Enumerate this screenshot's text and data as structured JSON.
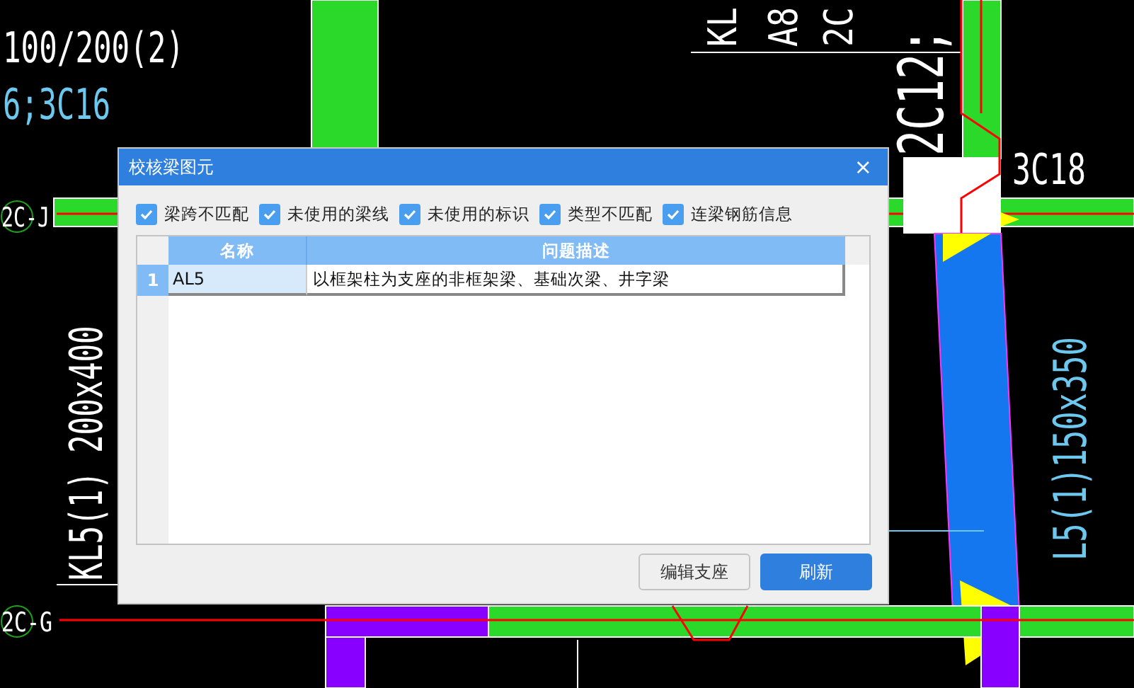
{
  "cad_labels": [
    {
      "text": "100/200(2)",
      "color": "#ffffff"
    },
    {
      "text": "6;3C16",
      "color": "#6cc8ee"
    },
    {
      "text": "KL",
      "color": "#ffffff"
    },
    {
      "text": "A8",
      "color": "#ffffff"
    },
    {
      "text": "2C",
      "color": "#ffffff"
    },
    {
      "text": "2C12;",
      "color": "#ffffff"
    },
    {
      "text": "3C18",
      "color": "#ffffff"
    },
    {
      "text": "2C-J",
      "color": "#ffffff"
    },
    {
      "text": "2C-G",
      "color": "#ffffff"
    },
    {
      "text": "KL5(1) 200x400",
      "color": "#ffffff"
    },
    {
      "text": "L5(1)150x350",
      "color": "#6cc8ee"
    }
  ],
  "dialog": {
    "title": "校核梁图元",
    "close": "×",
    "checkboxes": [
      {
        "label": "梁跨不匹配",
        "checked": true
      },
      {
        "label": "未使用的梁线",
        "checked": true
      },
      {
        "label": "未使用的标识",
        "checked": true
      },
      {
        "label": "类型不匹配",
        "checked": true
      },
      {
        "label": "连梁钢筋信息",
        "checked": true
      }
    ],
    "table": {
      "columns": [
        "名称",
        "问题描述"
      ],
      "rows": [
        {
          "index": "1",
          "cells": [
            "AL5",
            "以框架柱为支座的非框架梁、基础次梁、井字梁"
          ],
          "selected": true
        }
      ]
    },
    "buttons": [
      {
        "label": "编辑支座",
        "kind": "secondary"
      },
      {
        "label": "刷新",
        "kind": "primary"
      }
    ]
  }
}
